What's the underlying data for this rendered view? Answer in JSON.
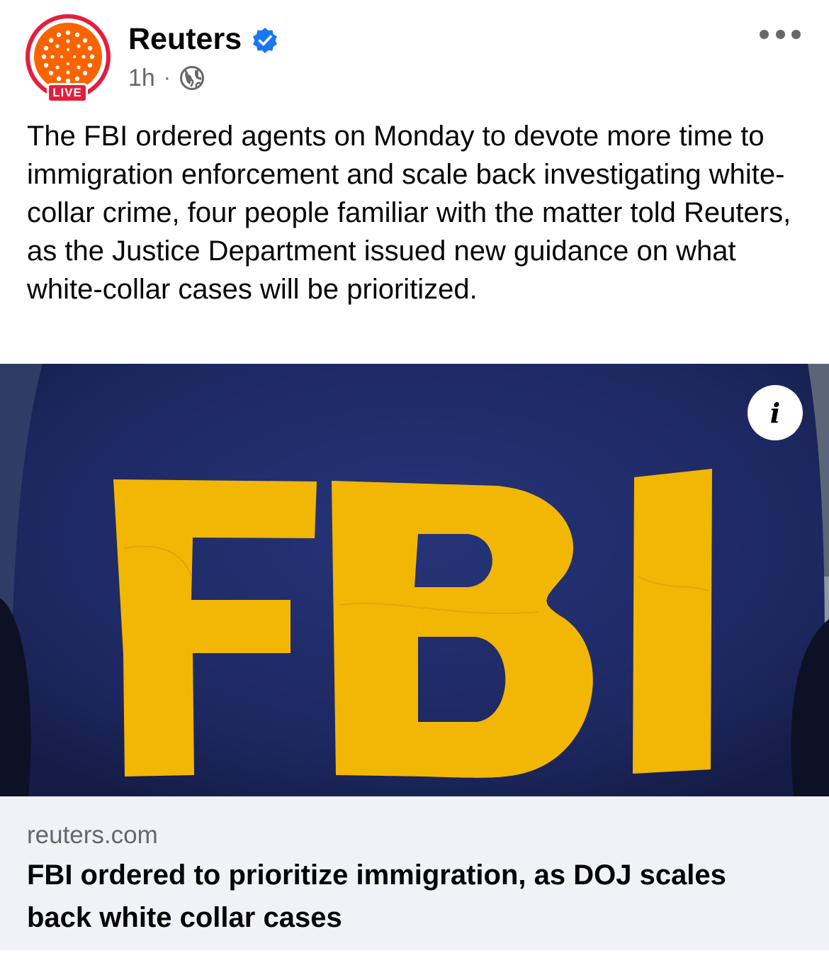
{
  "post": {
    "page_name": "Reuters",
    "live_label": "LIVE",
    "time": "1h",
    "separator": "·",
    "audience_icon": "globe-icon",
    "verified_icon": "verified-badge-icon",
    "menu_icon": "more-options-icon",
    "text": "The FBI ordered agents on Monday to devote more time to immigration enforcement and scale back investigating white-collar crime, four people familiar with the matter told Reuters, as the Justice Department issued new guidance on what white-collar cases will be prioritized."
  },
  "media": {
    "info_label": "i",
    "image_text": "FBI"
  },
  "link_preview": {
    "domain": "reuters.com",
    "title": "FBI ordered to prioritize immigration, as DOJ scales back white collar cases"
  },
  "colors": {
    "live_red": "#e41e3f",
    "reuters_orange": "#fa6400",
    "verified_blue": "#1877f2",
    "secondary_text": "#65676b",
    "shirt_navy": "#1f2a5c",
    "fbi_yellow": "#f2b705",
    "card_background": "#f0f2f5"
  }
}
